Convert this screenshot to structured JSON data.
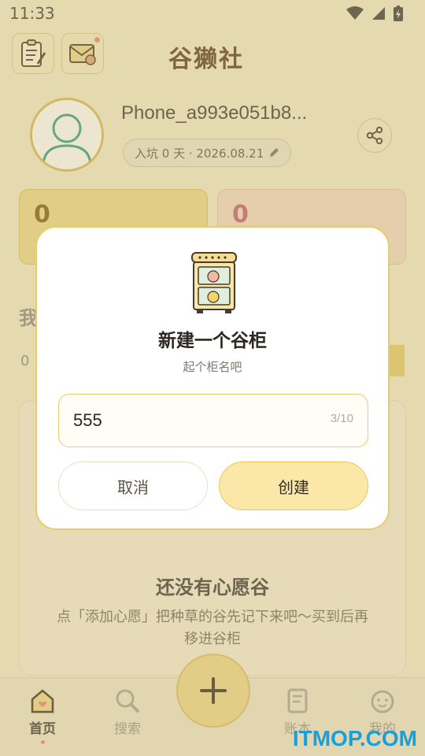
{
  "status_bar": {
    "time": "11:33"
  },
  "header": {
    "app_title": "谷獭社"
  },
  "profile": {
    "username": "Phone_a993e051b8...",
    "join_info": "入坑 0 天 · 2026.08.21"
  },
  "stats": [
    {
      "value": "0"
    },
    {
      "value": "0"
    }
  ],
  "section": {
    "title_peek": "我",
    "count_peek": "0"
  },
  "empty_state": {
    "title": "还没有心愿谷",
    "description": "点「添加心愿」把种草的谷先记下来吧～买到后再移进谷柜"
  },
  "bottom_nav": {
    "items": [
      {
        "label": "首页"
      },
      {
        "label": "搜索"
      },
      {
        "label": "账本"
      },
      {
        "label": "我的"
      }
    ]
  },
  "dialog": {
    "title": "新建一个谷柜",
    "subtitle": "起个柜名吧",
    "input_value": "555",
    "char_count": "3/10",
    "cancel_label": "取消",
    "create_label": "创建"
  },
  "watermark": "ITMOP.COM",
  "colors": {
    "accent": "#f0d98f",
    "accent_border": "#e6cc6a",
    "background": "#f3eccd",
    "dot": "#e48473"
  }
}
